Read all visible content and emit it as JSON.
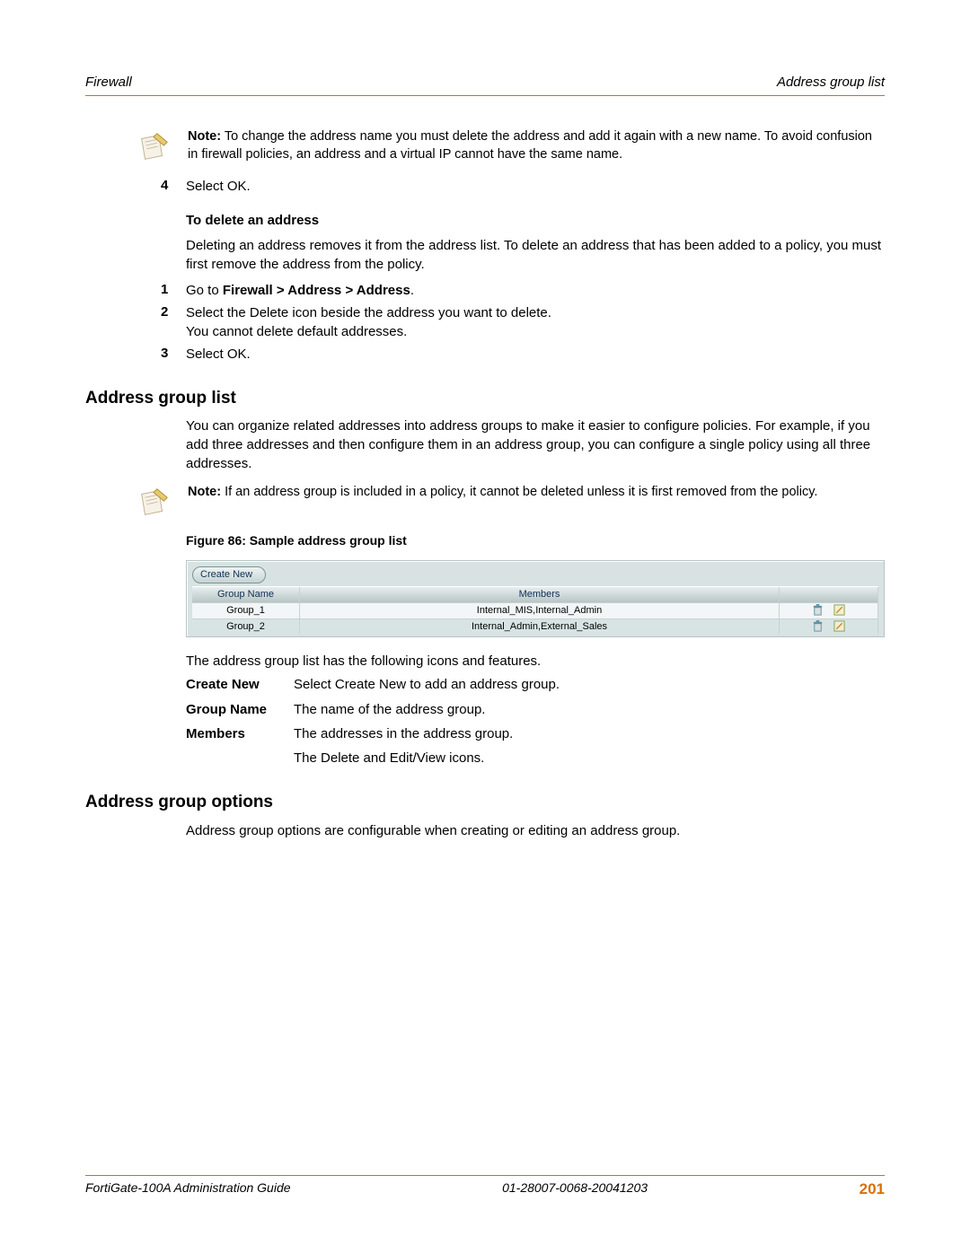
{
  "header": {
    "left": "Firewall",
    "right": "Address group list"
  },
  "note1": {
    "label": "Note:",
    "text": " To change the address name you must delete the address and add it again with a new name. To avoid confusion in firewall policies, an address and a virtual IP cannot have the same name."
  },
  "step4": {
    "num": "4",
    "text": "Select OK."
  },
  "delete_heading": "To delete an address",
  "delete_para": "Deleting an address removes it from the address list. To delete an address that has been added to a policy, you must first remove the address from the policy.",
  "del_steps": [
    {
      "num": "1",
      "pre": "Go to ",
      "bold": "Firewall > Address > Address",
      "post": "."
    },
    {
      "num": "2",
      "pre": "Select the Delete icon beside the address you want to delete.",
      "bold": "",
      "post": "",
      "line2": "You cannot delete default addresses."
    },
    {
      "num": "3",
      "pre": "Select OK.",
      "bold": "",
      "post": ""
    }
  ],
  "section1_title": "Address group list",
  "section1_para": "You can organize related addresses into address groups to make it easier to configure policies. For example, if you add three addresses and then configure them in an address group, you can configure a single policy using all three addresses.",
  "note2": {
    "label": "Note:",
    "text": " If an address group is included in a policy, it cannot be deleted unless it is first removed from the policy."
  },
  "figure_caption": "Figure 86: Sample address group list",
  "figure": {
    "create_new": "Create New",
    "col_name": "Group Name",
    "col_members": "Members",
    "rows": [
      {
        "name": "Group_1",
        "members": "Internal_MIS,Internal_Admin"
      },
      {
        "name": "Group_2",
        "members": "Internal_Admin,External_Sales"
      }
    ]
  },
  "features_intro": "The address group list has the following icons and features.",
  "features": [
    {
      "label": "Create New",
      "desc": "Select Create New to add an address group."
    },
    {
      "label": "Group Name",
      "desc": "The name of the address group."
    },
    {
      "label": "Members",
      "desc": "The addresses in the address group."
    },
    {
      "label": "",
      "desc": "The Delete and Edit/View icons."
    }
  ],
  "section2_title": "Address group options",
  "section2_para": "Address group options are configurable when creating or editing an address group.",
  "footer": {
    "left": "FortiGate-100A Administration Guide",
    "center": "01-28007-0068-20041203",
    "page": "201"
  }
}
